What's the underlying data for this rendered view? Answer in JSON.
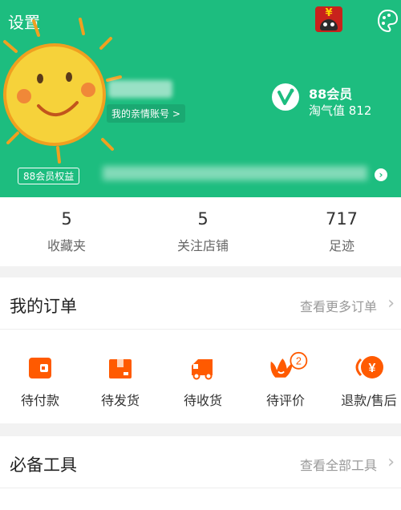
{
  "header": {
    "settings_label": "设置",
    "avatar_badge_symbol": "¥",
    "account_link_label": "我的亲情账号 >",
    "vip": {
      "title": "88会员",
      "score_label": "淘气值 812"
    },
    "vip_benefit_label": "88会员权益",
    "arrow_symbol": "›",
    "background_color": "#1dbd7f"
  },
  "stats": [
    {
      "value": "5",
      "label": "收藏夹"
    },
    {
      "value": "5",
      "label": "关注店铺"
    },
    {
      "value": "717",
      "label": "足迹"
    }
  ],
  "orders": {
    "title": "我的订单",
    "more_label": "查看更多订单",
    "chevron": "›",
    "items": [
      {
        "label": "待付款",
        "icon": "wallet-icon"
      },
      {
        "label": "待发货",
        "icon": "package-icon"
      },
      {
        "label": "待收货",
        "icon": "truck-icon"
      },
      {
        "label": "待评价",
        "icon": "review-icon",
        "badge": "2"
      },
      {
        "label": "退款/售后",
        "icon": "refund-icon",
        "symbol": "¥"
      }
    ],
    "accent_color": "#ff5a00"
  },
  "tools": {
    "title": "必备工具",
    "more_label": "查看全部工具",
    "chevron": "›"
  }
}
